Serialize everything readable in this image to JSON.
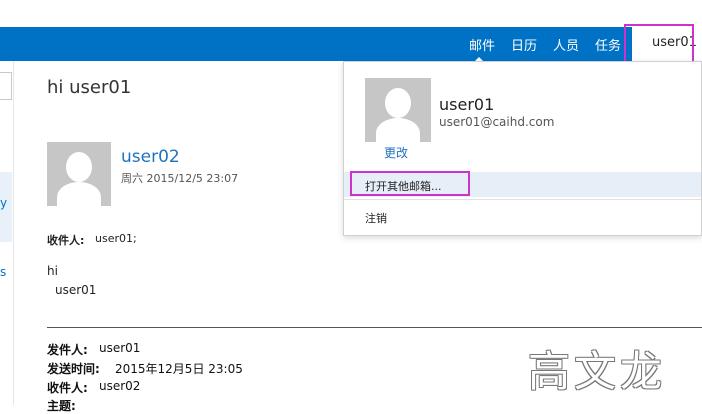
{
  "topbar": {
    "nav": [
      "邮件",
      "日历",
      "人员",
      "任务"
    ],
    "user_label": "user01",
    "accent": "#0072c6"
  },
  "left_strip": {
    "glyph1": "y",
    "glyph2": "s"
  },
  "message": {
    "subject": "hi user01",
    "sender_name": "user02",
    "sender_date": "周六 2015/12/5 23:07",
    "recipients_label": "收件人:",
    "recipients_value": "user01;",
    "body_line1": "hi",
    "body_line2": "user01",
    "quoted": {
      "from_label": "发件人:",
      "from_value": "user01",
      "sent_label": "发送时间:",
      "sent_value": "2015年12月5日 23:05",
      "to_label": "收件人:",
      "to_value": "user02",
      "subject_label": "主题:"
    }
  },
  "account_menu": {
    "name": "user01",
    "email": "user01@caihd.com",
    "change_label": "更改",
    "open_other_label": "打开其他邮箱...",
    "signout_label": "注销"
  },
  "watermark": "高文龙",
  "highlight_color": "#cc33cc"
}
